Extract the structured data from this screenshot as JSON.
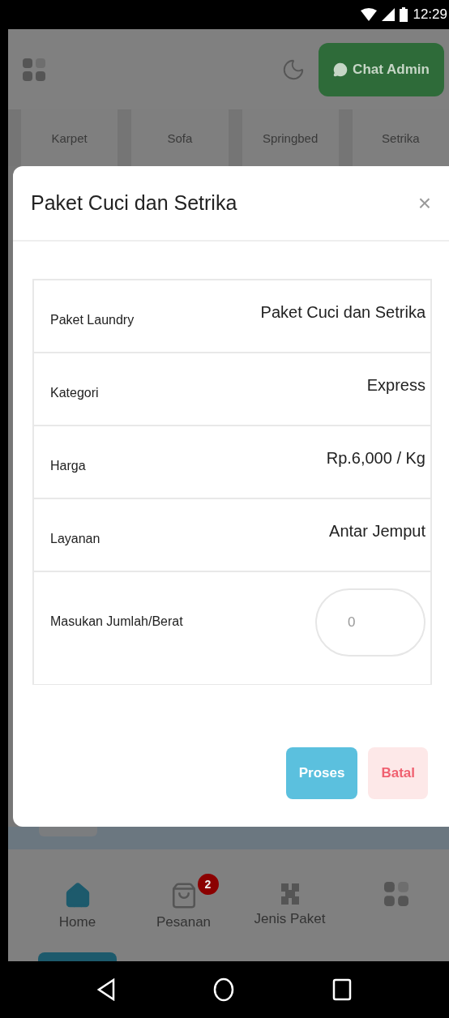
{
  "status_bar": {
    "time": "12:29"
  },
  "header": {
    "chat_button": "Chat Admin"
  },
  "categories": [
    "Karpet",
    "Sofa",
    "Springbed",
    "Setrika"
  ],
  "modal": {
    "title": "Paket Cuci dan Setrika",
    "close": "×",
    "rows": [
      {
        "kind": "text",
        "label": "Paket Laundry",
        "value": "Paket Cuci dan Setrika"
      },
      {
        "kind": "text",
        "label": "Kategori",
        "value": "Express"
      },
      {
        "kind": "text",
        "label": "Harga",
        "value": "Rp.6,000 / Kg"
      },
      {
        "kind": "text",
        "label": "Layanan",
        "value": "Antar Jemput"
      },
      {
        "kind": "input",
        "label": "Masukan Jumlah/Berat",
        "placeholder": "0"
      }
    ],
    "buttons": [
      {
        "kind": "primary",
        "label": "Proses"
      },
      {
        "kind": "danger",
        "label": "Batal"
      }
    ]
  },
  "bottom_nav": [
    {
      "kind": "home",
      "label": "Home",
      "selected": true
    },
    {
      "kind": "bag",
      "label": "Pesanan",
      "badge": "2",
      "selected": false
    },
    {
      "kind": "shapes",
      "label": "Jenis Paket",
      "selected": false
    },
    {
      "kind": "grid",
      "selected": false
    }
  ]
}
